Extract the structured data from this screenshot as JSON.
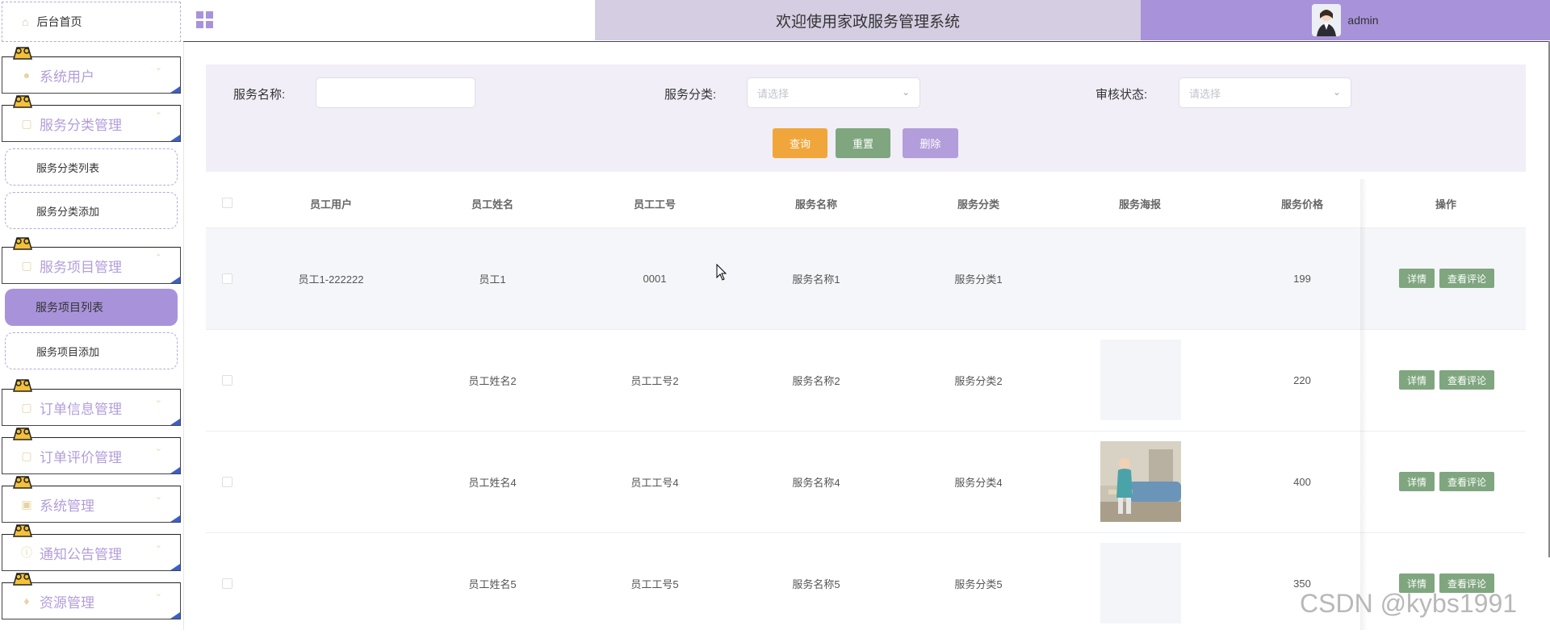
{
  "header": {
    "title": "欢迎使用家政服务管理系统",
    "username": "admin"
  },
  "sidebar": {
    "home": "后台首页",
    "groups": [
      {
        "label": "系统用户",
        "icon": "user-icon"
      },
      {
        "label": "服务分类管理",
        "icon": "doc-icon"
      },
      {
        "label": "服务项目管理",
        "icon": "doc-icon"
      },
      {
        "label": "订单信息管理",
        "icon": "doc-icon"
      },
      {
        "label": "订单评价管理",
        "icon": "doc-icon"
      },
      {
        "label": "系统管理",
        "icon": "image-icon"
      },
      {
        "label": "通知公告管理",
        "icon": "info-icon"
      },
      {
        "label": "资源管理",
        "icon": "bulb-icon"
      }
    ],
    "subs": {
      "category_list": "服务分类列表",
      "category_add": "服务分类添加",
      "project_list": "服务项目列表",
      "project_add": "服务项目添加"
    }
  },
  "search": {
    "name_label": "服务名称:",
    "name_value": "",
    "category_label": "服务分类:",
    "category_placeholder": "请选择",
    "status_label": "审核状态:",
    "status_placeholder": "请选择",
    "query": "查询",
    "reset": "重置",
    "delete": "删除"
  },
  "table": {
    "columns": [
      "员工用户",
      "员工姓名",
      "员工工号",
      "服务名称",
      "服务分类",
      "服务海报",
      "服务价格",
      "操作"
    ],
    "rows": [
      {
        "user": "员工1-222222",
        "name": "员工1",
        "no": "0001",
        "service": "服务名称1",
        "category": "服务分类1",
        "poster": "none",
        "price": "199"
      },
      {
        "user": "",
        "name": "员工姓名2",
        "no": "员工工号2",
        "service": "服务名称2",
        "category": "服务分类2",
        "poster": "blank",
        "price": "220"
      },
      {
        "user": "",
        "name": "员工姓名4",
        "no": "员工工号4",
        "service": "服务名称4",
        "category": "服务分类4",
        "poster": "photo",
        "price": "400"
      },
      {
        "user": "",
        "name": "员工姓名5",
        "no": "员工工号5",
        "service": "服务名称5",
        "category": "服务分类5",
        "poster": "blank",
        "price": "350"
      }
    ],
    "detail": "详情",
    "review": "查看评论"
  },
  "watermark": "CSDN @kybs1991",
  "colors": {
    "accent": "#a893db",
    "query": "#f0a63a",
    "reset": "#7fa67f",
    "delete": "#b39ddb"
  }
}
